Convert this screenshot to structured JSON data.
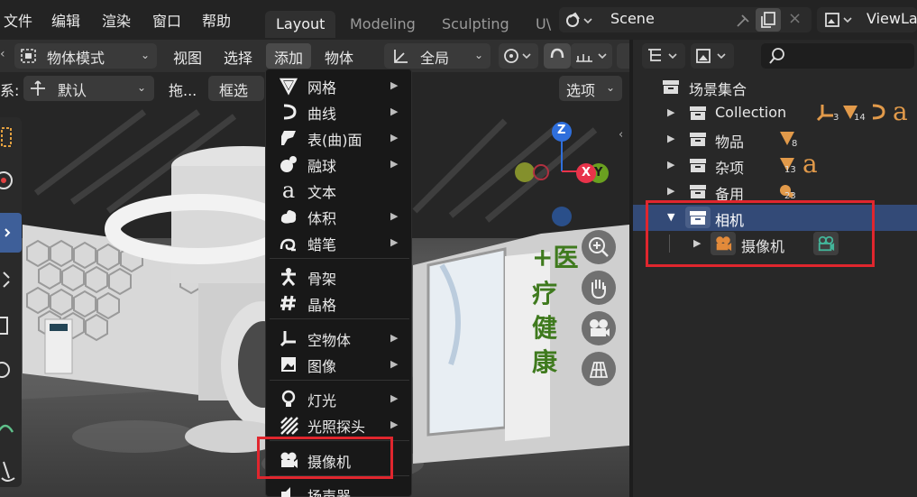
{
  "menubar": {
    "items": [
      "文件",
      "编辑",
      "渲染",
      "窗口",
      "帮助"
    ]
  },
  "workspace_tabs": [
    "Layout",
    "Modeling",
    "Sculpting",
    "U\\"
  ],
  "scene": {
    "label": "Scene"
  },
  "viewlayer": {
    "label": "ViewLa"
  },
  "viewport_header": {
    "mode": "物体模式",
    "view": "视图",
    "select": "选择",
    "add": "添加",
    "object": "物体",
    "transform_space": "全局"
  },
  "viewport_header2": {
    "orientation_prefix": "系:",
    "orientation": "默认",
    "drag": "拖...",
    "box_select": "框选",
    "options": "选项"
  },
  "add_menu": {
    "items": [
      {
        "label": "网格",
        "icon": "mesh-icon",
        "submenu": true
      },
      {
        "label": "曲线",
        "icon": "curve-icon",
        "submenu": true
      },
      {
        "label": "表(曲)面",
        "icon": "surface-icon",
        "submenu": true
      },
      {
        "label": "融球",
        "icon": "metaball-icon",
        "submenu": true
      },
      {
        "label": "文本",
        "icon": "text-icon",
        "submenu": false
      },
      {
        "label": "体积",
        "icon": "volume-icon",
        "submenu": true
      },
      {
        "label": "蜡笔",
        "icon": "grease-pencil-icon",
        "submenu": true
      },
      {
        "label": "骨架",
        "icon": "armature-icon",
        "submenu": false
      },
      {
        "label": "晶格",
        "icon": "lattice-icon",
        "submenu": false
      },
      {
        "label": "空物体",
        "icon": "empty-icon",
        "submenu": true
      },
      {
        "label": "图像",
        "icon": "image-icon",
        "submenu": true
      },
      {
        "label": "灯光",
        "icon": "light-icon",
        "submenu": true
      },
      {
        "label": "光照探头",
        "icon": "light-probe-icon",
        "submenu": true
      },
      {
        "label": "摄像机",
        "icon": "camera-icon",
        "submenu": false
      },
      {
        "label": "扬声器",
        "icon": "speaker-icon",
        "submenu": false
      }
    ]
  },
  "viewport_scene_text": [
    "+医",
    "疗",
    "健",
    "康"
  ],
  "gizmo": {
    "z": "Z",
    "x": "X",
    "y": "Y"
  },
  "outliner": {
    "root": "场景集合",
    "rows": [
      {
        "label": "Collection",
        "counts": [
          "3",
          "14"
        ],
        "text_glyph": "a"
      },
      {
        "label": "物品",
        "counts": [
          "8"
        ],
        "text_glyph": ""
      },
      {
        "label": "杂项",
        "counts": [
          "13"
        ],
        "text_glyph": "a"
      },
      {
        "label": "备用",
        "counts": [
          "23"
        ],
        "text_glyph": ""
      },
      {
        "label": "相机",
        "counts": [],
        "text_glyph": ""
      },
      {
        "label": "摄像机",
        "counts": [],
        "text_glyph": ""
      }
    ]
  },
  "colors": {
    "accent_red": "#e0262e",
    "selection_blue": "#334a77",
    "gizmo_z": "#2f6fdc",
    "gizmo_x": "#e8334a",
    "gizmo_y": "#6aa020",
    "camera_orange": "#e28a3a",
    "camera_teal": "#43b59a"
  }
}
